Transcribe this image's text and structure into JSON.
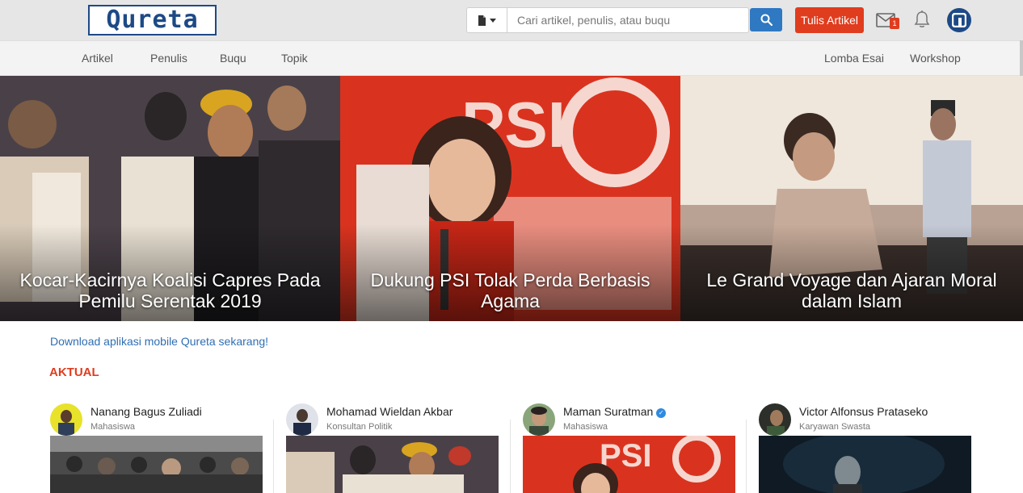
{
  "header": {
    "logo_text": "Qureta",
    "search": {
      "type_icon": "document-icon",
      "placeholder": "Cari artikel, penulis, atau buqu"
    },
    "write_button": "Tulis Artikel",
    "mail_badge": "1",
    "colors": {
      "brand": "#1d4a86",
      "accent": "#e03c1e",
      "search_button": "#2f78c2"
    }
  },
  "nav": {
    "left": [
      "Artikel",
      "Penulis",
      "Buqu",
      "Topik"
    ],
    "right": [
      "Lomba Esai",
      "Workshop"
    ]
  },
  "hero": [
    {
      "title": "Kocar-Kacirnya Koalisi Capres Pada Pemilu Serentak 2019"
    },
    {
      "title": "Dukung PSI Tolak Perda Berbasis Agama"
    },
    {
      "title": "Le Grand Voyage dan Ajaran Moral dalam Islam"
    }
  ],
  "download_text": "Download aplikasi mobile Qureta sekarang",
  "download_suffix": "!",
  "section_title": "AKTUAL",
  "cards": [
    {
      "author": "Nanang Bagus Zuliadi",
      "role": "Mahasiswa",
      "verified": false
    },
    {
      "author": "Mohamad Wieldan Akbar",
      "role": "Konsultan Politik",
      "verified": false
    },
    {
      "author": "Maman Suratman",
      "role": "Mahasiswa",
      "verified": true
    },
    {
      "author": "Victor Alfonsus Prataseko",
      "role": "Karyawan Swasta",
      "verified": false
    }
  ]
}
